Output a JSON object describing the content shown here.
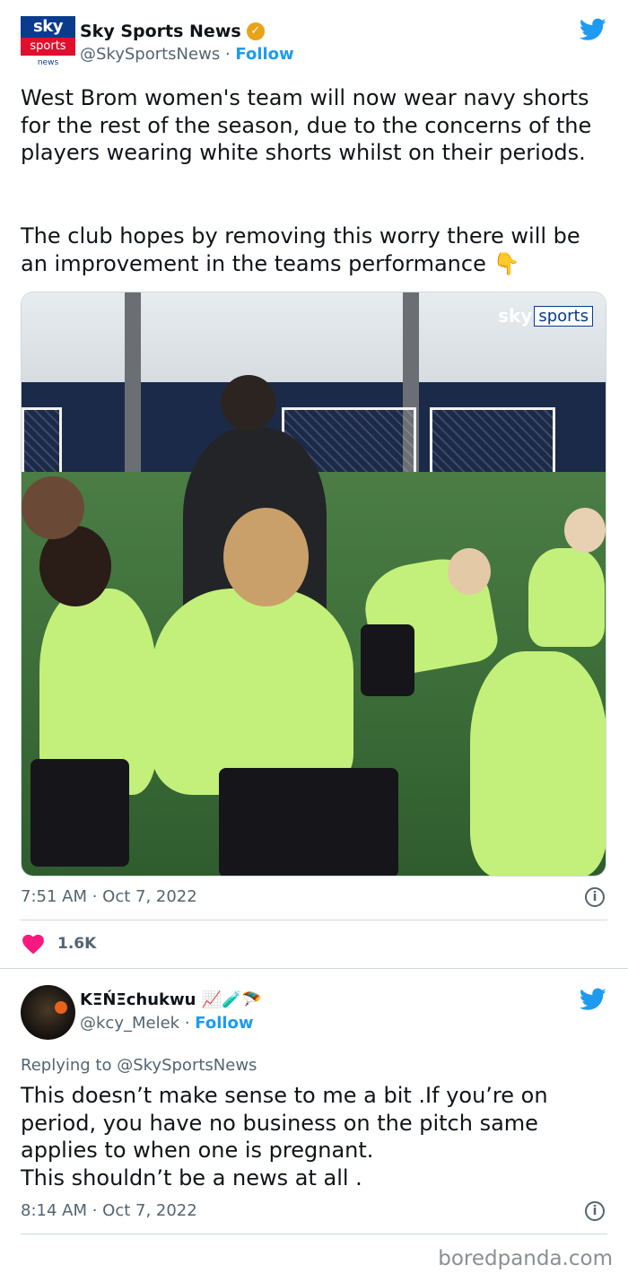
{
  "tweet1": {
    "avatar": {
      "sky": "sky",
      "sports": "sports",
      "news": "news"
    },
    "name": "Sky Sports News",
    "handle": "@SkySportsNews",
    "separator": "·",
    "follow_label": "Follow",
    "text_p1": "West Brom women's team will now wear navy shorts for the rest of the season, due to the concerns of the players wearing white shorts whilst on their periods.",
    "text_p2": "The club hopes by removing this worry there will be an improvement in the teams performance 👇",
    "media_watermark": {
      "sky": "sky",
      "sports": "sports"
    },
    "timestamp": "7:51 AM · Oct 7, 2022",
    "likes": "1.6K",
    "icons": [
      "twitter-bird-icon",
      "verified-badge-icon",
      "info-icon",
      "heart-icon"
    ]
  },
  "tweet2": {
    "name": "KΞŃΞchukwu 📈🧪🪂",
    "handle": "@kcy_Melek",
    "separator": "·",
    "follow_label": "Follow",
    "replying_to_prefix": "Replying to",
    "replying_to_handle": "@SkySportsNews",
    "text_lines": [
      "This doesn’t make sense to me a bit .If you’re on",
      "period, you have no business on the pitch same",
      "applies to when one is pregnant.",
      "This shouldn’t be a news at all ."
    ],
    "timestamp": "8:14 AM · Oct 7, 2022"
  },
  "footer": "boredpanda.com",
  "colors": {
    "accent": "#1d9bf0",
    "text": "#0f1419",
    "muted": "#536471",
    "heart": "#f91880",
    "verified": "#e8a317"
  }
}
